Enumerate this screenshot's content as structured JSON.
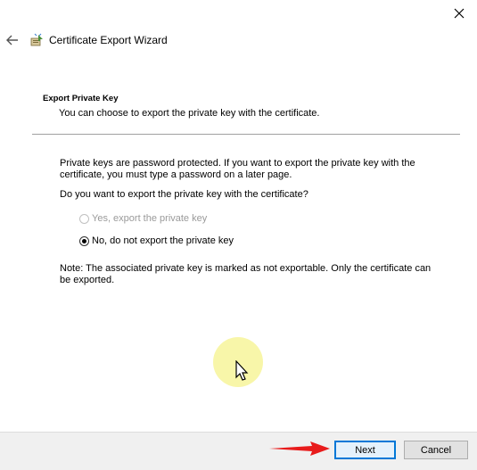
{
  "window": {
    "title": "Certificate Export Wizard",
    "close_icon": "close-icon",
    "back_icon": "back-arrow-icon",
    "wizard_icon": "certificate-wizard-icon"
  },
  "header": {
    "title": "Export Private Key",
    "description": "You can choose to export the private key with the certificate."
  },
  "body": {
    "intro": "Private keys are password protected. If you want to export the private key with the certificate, you must type a password on a later page.",
    "question": "Do you want to export the private key with the certificate?",
    "options": [
      {
        "label": "Yes, export the private key",
        "selected": false,
        "enabled": false
      },
      {
        "label": "No, do not export the private key",
        "selected": true,
        "enabled": true
      }
    ],
    "note": "Note: The associated private key is marked as not exportable. Only the certificate can be exported."
  },
  "footer": {
    "next_label": "Next",
    "cancel_label": "Cancel"
  },
  "colors": {
    "focus_border": "#0078d7",
    "annotation_arrow": "#e81b1b",
    "cursor_highlight": "#f7f49a"
  }
}
